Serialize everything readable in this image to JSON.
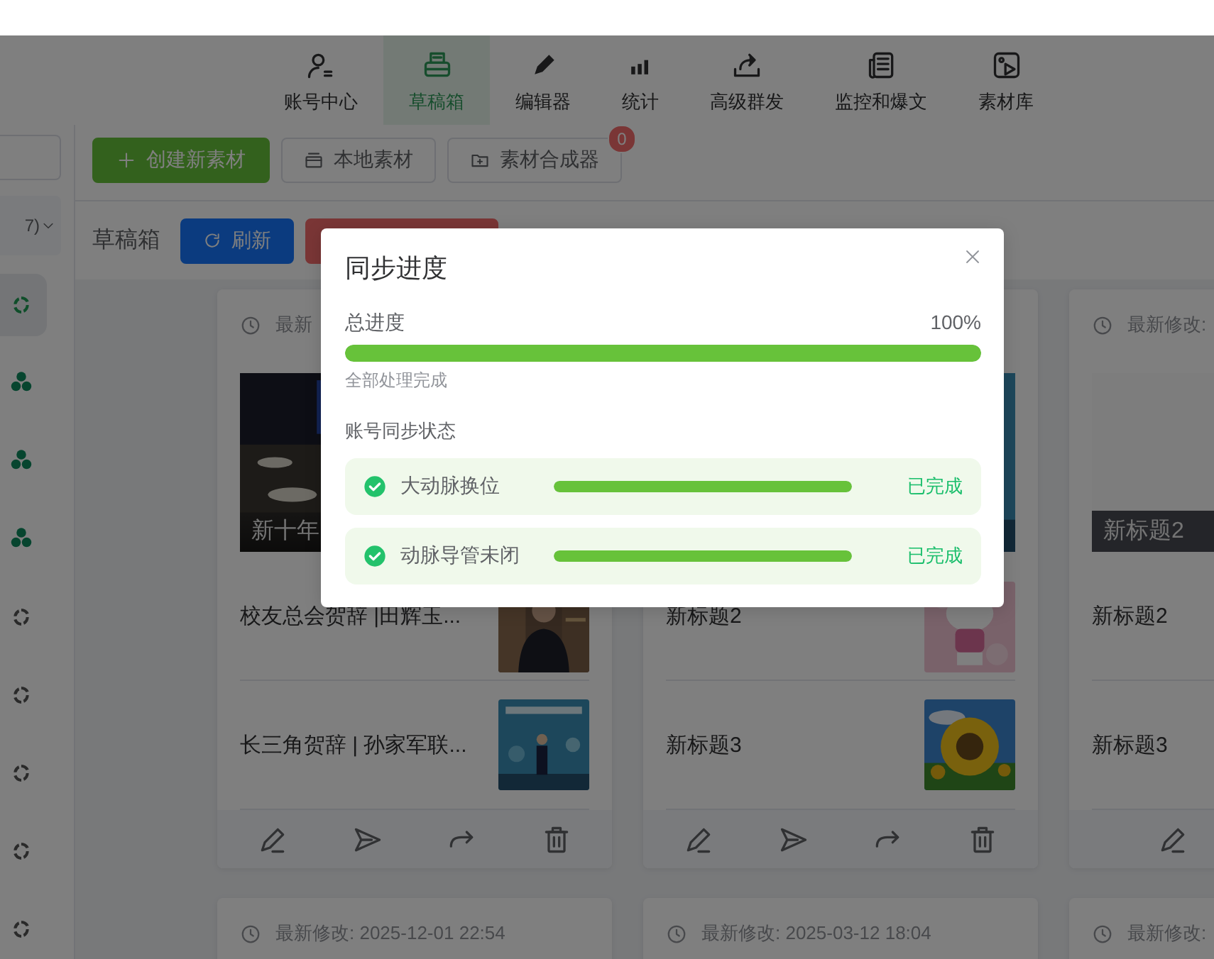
{
  "nav": [
    {
      "label": "账号中心",
      "selected": false
    },
    {
      "label": "草稿箱",
      "selected": true
    },
    {
      "label": "编辑器",
      "selected": false
    },
    {
      "label": "统计",
      "selected": false
    },
    {
      "label": "高级群发",
      "selected": false
    },
    {
      "label": "监控和爆文",
      "selected": false
    },
    {
      "label": "素材库",
      "selected": false
    }
  ],
  "sidebar": {
    "dropdown": "7)",
    "items": [
      {
        "kind": "swirl",
        "selected": true
      },
      {
        "kind": "hexagons",
        "selected": false
      },
      {
        "kind": "hexagons",
        "selected": false
      },
      {
        "kind": "hexagons",
        "selected": false
      },
      {
        "kind": "swirl",
        "selected": false
      },
      {
        "kind": "swirl",
        "selected": false
      },
      {
        "kind": "swirl",
        "selected": false
      },
      {
        "kind": "swirl",
        "selected": false
      },
      {
        "kind": "swirl",
        "selected": false
      }
    ]
  },
  "toolbar": [
    {
      "kind": "primary",
      "label": "创建新素材"
    },
    {
      "kind": "local",
      "label": "本地素材"
    },
    {
      "kind": "composer",
      "label": "素材合成器",
      "badge": "0"
    }
  ],
  "section": {
    "title": "草稿箱",
    "buttons": [
      {
        "kind": "refresh",
        "label": "刷新"
      },
      {
        "kind": "danger"
      }
    ]
  },
  "cards": [
    {
      "modified": "最新",
      "cover": {
        "kind": "picture",
        "title": "新十年"
      },
      "articles": [
        {
          "title": "校友总会贺辞 |田辉玉...",
          "thumbnail": true
        },
        {
          "title": "长三角贺辞 | 孙家军联...",
          "thumbnail": true
        }
      ]
    },
    {
      "cover": {
        "kind": "picture"
      },
      "articles": [
        {
          "title": "新标题2",
          "thumbnail": true
        },
        {
          "title": "新标题3",
          "thumbnail": true
        }
      ]
    },
    {
      "modified": "最新修改:",
      "cover": {
        "kind": "plain",
        "title": "新标题2"
      },
      "articles": [
        {
          "title": "新标题2"
        },
        {
          "title": "新标题3"
        }
      ]
    }
  ],
  "more_cards": [
    {
      "modified": "最新修改: 2025-12-01 22:54"
    },
    {
      "modified": "最新修改: 2025-03-12 18:04"
    },
    {
      "modified": "最新修改:"
    }
  ],
  "dialog": {
    "title": "同步进度",
    "overall": {
      "label": "总进度",
      "reading": "100%",
      "level": 1
    },
    "summary": "全部处理完成",
    "section_title": "账号同步状态",
    "accounts": [
      {
        "name": "大动脉换位",
        "level": 1,
        "status": "已完成"
      },
      {
        "name": "动脉导管未闭",
        "level": 1,
        "status": "已完成"
      }
    ]
  }
}
